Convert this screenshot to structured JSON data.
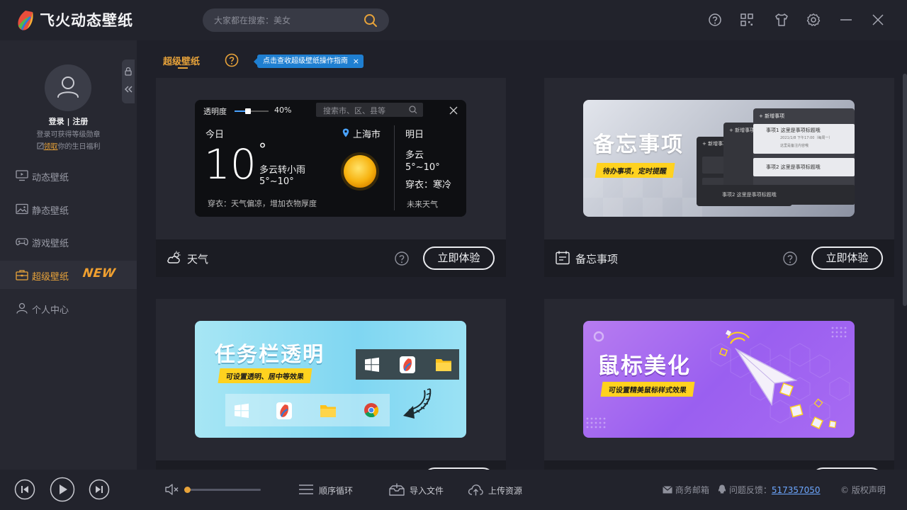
{
  "app": {
    "title": "飞火动态壁纸",
    "search_placeholder": "大家都在搜索：美女"
  },
  "user": {
    "login_label": "登录 | 注册",
    "login_hint": "登录可获得等级勋章",
    "birthday_claim": "领取",
    "birthday_text": "你的生日福利"
  },
  "sidebar": {
    "items": [
      {
        "label": "动态壁纸",
        "icon": "monitor-icon"
      },
      {
        "label": "静态壁纸",
        "icon": "image-icon"
      },
      {
        "label": "游戏壁纸",
        "icon": "gamepad-icon"
      },
      {
        "label": "超级壁纸",
        "icon": "briefcase-icon",
        "active": true
      },
      {
        "label": "个人中心",
        "icon": "person-icon"
      }
    ],
    "new_badge": "NEW"
  },
  "main": {
    "section_title": "超级壁纸",
    "guide_tip": "点击查收超级壁纸操作指南",
    "guide_close": "×"
  },
  "cards": [
    {
      "name": "天气",
      "icon": "weather-icon",
      "try_label": "立即体验",
      "preview": {
        "opacity_label": "透明度",
        "opacity_value": "40%",
        "opacity": 0.4,
        "search_placeholder": "搜索市、区、县等",
        "today_label": "今日",
        "city": "上海市",
        "temperature": "10",
        "degree": "°",
        "condition": "多云转小雨",
        "range": "5°~10°",
        "dress": "穿衣：天气偏凉，增加衣物厚度",
        "tomorrow_label": "明日",
        "tomorrow_condition": "多云",
        "tomorrow_range": "5°~10°",
        "tomorrow_dress": "穿衣：寒冷",
        "future_label": "未来天气"
      }
    },
    {
      "name": "备忘事项",
      "icon": "memo-icon",
      "try_label": "立即体验",
      "preview": {
        "title": "备忘事项",
        "tag": "待办事项，定时提醒",
        "add_label": "+ 新增事项",
        "item1": "事项1  这里是事项标题哦",
        "item1_sub": "2021/1/8 下午17:00（每周一）",
        "item1_note": "这里是备注内容哦",
        "item2": "事项2  这里是事项标题哦"
      }
    },
    {
      "name": "",
      "icon": "",
      "try_label": "",
      "preview": {
        "title": "任务栏透明",
        "tag": "可设置透明、居中等效果"
      }
    },
    {
      "name": "",
      "icon": "",
      "try_label": "",
      "preview": {
        "title": "鼠标美化",
        "tag": "可设置精美鼠标样式效果"
      }
    }
  ],
  "player": {
    "volume": 0.02,
    "loop_label": "顺序循环",
    "import_label": "导入文件",
    "upload_label": "上传资源"
  },
  "footer": {
    "mail_label": "商务邮箱",
    "feedback_label": "问题反馈：",
    "feedback_qq": "517357050",
    "copyright_label": "© 版权声明"
  },
  "colors": {
    "accent": "#e8a33a",
    "tip_blue": "#1f7fd1",
    "background": "#1f2029",
    "sidebar": "#272831"
  }
}
